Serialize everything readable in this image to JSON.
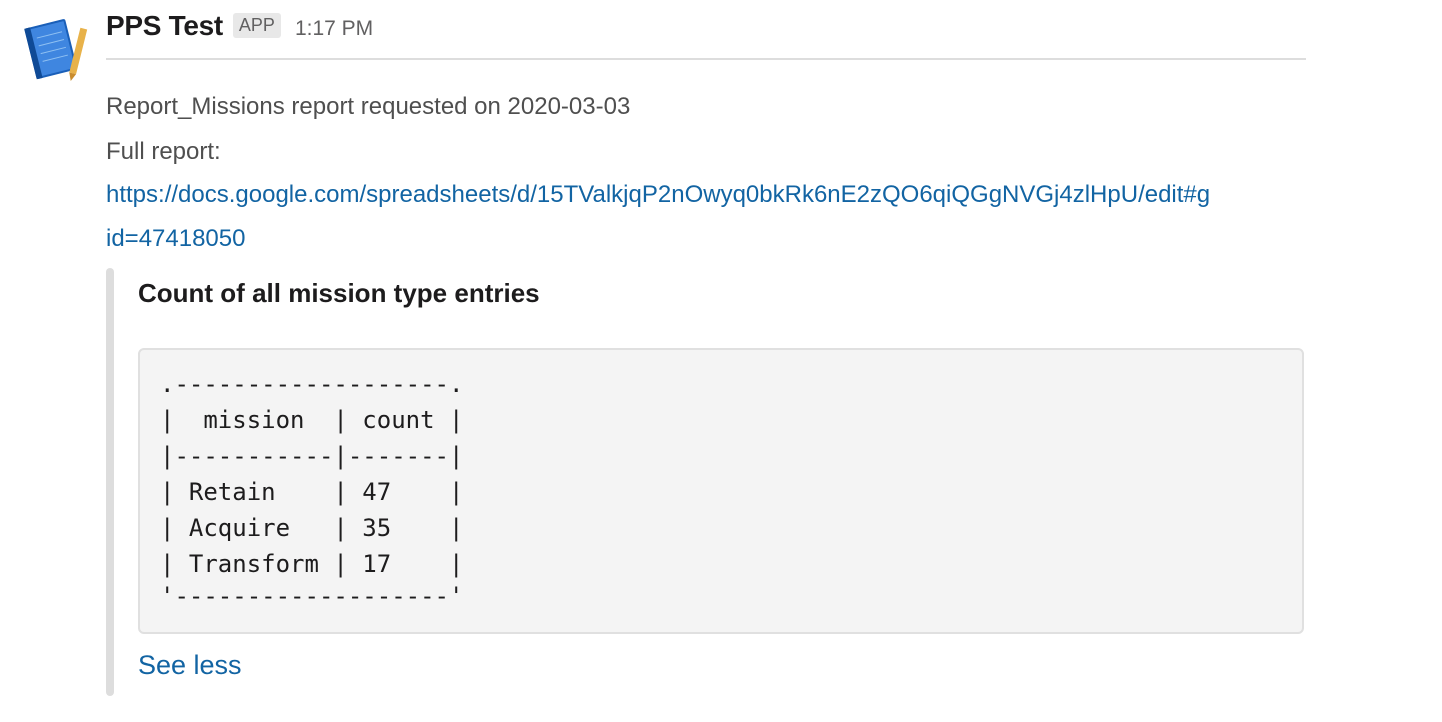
{
  "message": {
    "sender": "PPS Test",
    "badge": "APP",
    "timestamp": "1:17 PM",
    "lines": [
      "Report_Missions report requested on 2020-03-03",
      "Full report:"
    ],
    "url_parts": [
      "https://docs.google.com/spreadsheets/d/15TValkjqP2nOwyq0bkRk6nE2zQO6qiQGgNVGj4zlHpU/edit#g",
      "id=47418050"
    ]
  },
  "attachment": {
    "title": "Count of all mission type entries",
    "code_lines": [
      ".-------------------.",
      "|  mission  | count |",
      "|-----------|-------|",
      "| Retain    | 47    |",
      "| Acquire   | 35    |",
      "| Transform | 17    |",
      "'-------------------'"
    ],
    "toggle_label": "See less"
  },
  "colors": {
    "link": "#1264a3",
    "text": "#1d1c1d",
    "muted": "#616061",
    "code_bg": "#f4f4f4"
  },
  "icons": {
    "avatar": "app-notebook-icon"
  }
}
